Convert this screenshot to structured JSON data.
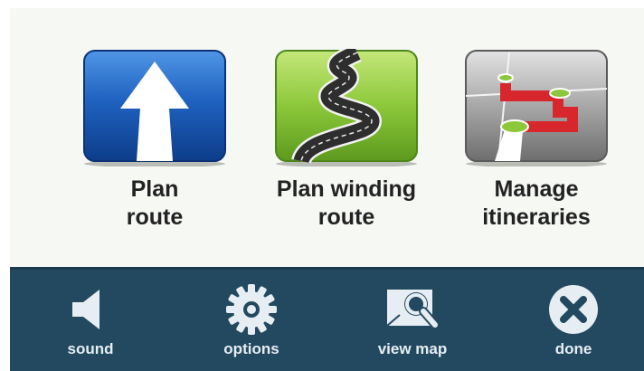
{
  "menu": {
    "tiles": [
      {
        "icon": "plan-route-arrow-icon",
        "label_line1": "Plan",
        "label_line2": "route"
      },
      {
        "icon": "winding-road-icon",
        "label_line1": "Plan winding",
        "label_line2": "route"
      },
      {
        "icon": "itinerary-map-icon",
        "label_line1": "Manage",
        "label_line2": "itineraries"
      }
    ]
  },
  "toolbar": {
    "buttons": [
      {
        "icon": "speaker-icon",
        "label": "sound"
      },
      {
        "icon": "gear-icon",
        "label": "options"
      },
      {
        "icon": "map-search-icon",
        "label": "view map"
      },
      {
        "icon": "close-circle-icon",
        "label": "done"
      }
    ]
  },
  "colors": {
    "toolbar_bg": "#22495f",
    "plan_route_blue": "#1f5fb8",
    "winding_green": "#8cc83a",
    "itineraries_grey": "#8c8c8c",
    "route_red": "#d8262d"
  }
}
